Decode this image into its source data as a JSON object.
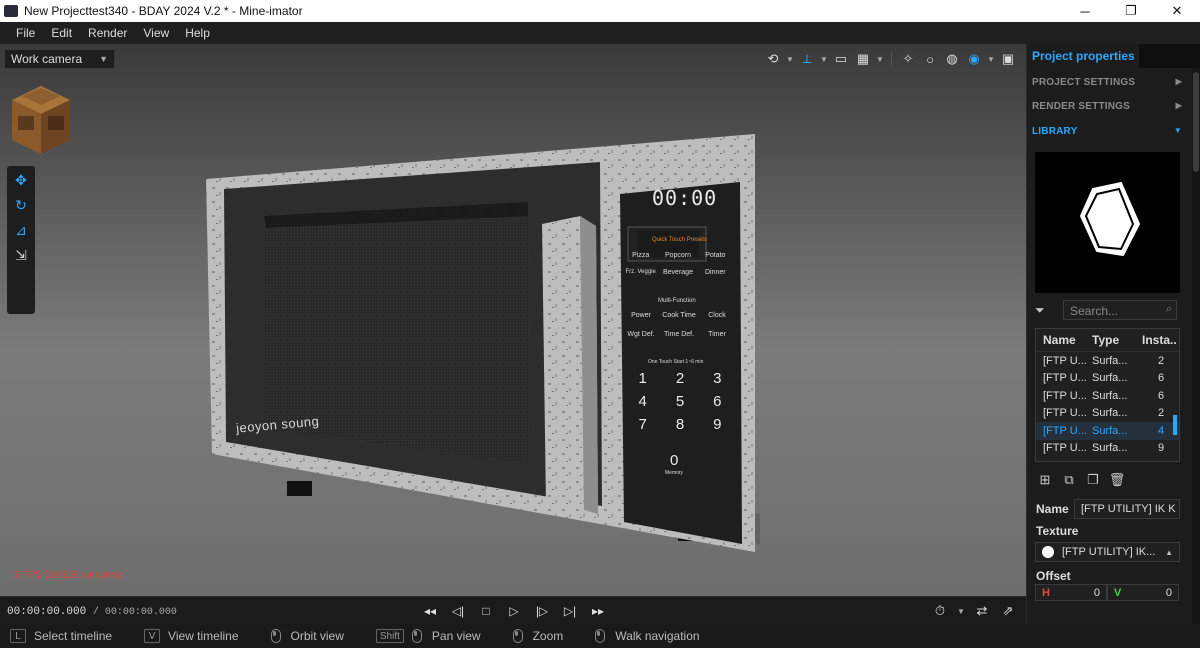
{
  "window": {
    "title": "New Projecttest340 - BDAY 2024 V.2 * - Mine-imator",
    "minimize": "─",
    "maximize": "❐",
    "close": "✕"
  },
  "menu": {
    "file": "File",
    "edit": "Edit",
    "render": "Render",
    "view": "View",
    "help": "Help"
  },
  "viewport": {
    "camera": "Work camera",
    "fps": "3 FPS (18/128 samples)"
  },
  "microwave": {
    "clock": "00:00",
    "presets_title": "Quick Touch Presets",
    "presets": [
      "Pizza",
      "Popcorn",
      "Potato",
      "Frz. Veggie",
      "Beverage",
      "Dinner"
    ],
    "multi_title": "Multi-Function",
    "multi": [
      "Power",
      "Cook Time",
      "Clock",
      "Wgt Def.",
      "Time Def.",
      "Timer"
    ],
    "start_title": "One Touch Start 1~6 min",
    "digits": [
      "1",
      "2",
      "3",
      "4",
      "5",
      "6",
      "7",
      "8",
      "9"
    ],
    "zero": "0",
    "memory": "Memory",
    "brand": "jeoyon soung"
  },
  "timeline": {
    "current": "00:00:00.000",
    "duration": "/ 00:00:00.000"
  },
  "status": {
    "select_key": "L",
    "select_timeline": "Select timeline",
    "view_key": "V",
    "view_timeline": "View timeline",
    "orbit_view": "Orbit view",
    "shift_key": "Shift",
    "pan_view": "Pan view",
    "zoom": "Zoom",
    "walk_navigation": "Walk navigation"
  },
  "panel": {
    "tab": "Project properties",
    "project_settings": "PROJECT SETTINGS",
    "render_settings": "RENDER SETTINGS",
    "library": "LIBRARY",
    "search_placeholder": "Search...",
    "columns": [
      "Name",
      "Type",
      "Insta..."
    ],
    "rows": [
      {
        "name": "[FTP U...",
        "type": "Surfa...",
        "count": "2"
      },
      {
        "name": "[FTP U...",
        "type": "Surfa...",
        "count": "6"
      },
      {
        "name": "[FTP U...",
        "type": "Surfa...",
        "count": "6"
      },
      {
        "name": "[FTP U...",
        "type": "Surfa...",
        "count": "2"
      },
      {
        "name": "[FTP U...",
        "type": "Surfa...",
        "count": "4"
      },
      {
        "name": "[FTP U...",
        "type": "Surfa...",
        "count": "9"
      }
    ],
    "selected_row": 4,
    "name_label": "Name",
    "name_value": "[FTP UTILITY] IK K",
    "texture_label": "Texture",
    "texture_value": "[FTP UTILITY] IK...",
    "offset_label": "Offset",
    "offset_h_label": "H",
    "offset_h": "0",
    "offset_v_label": "V",
    "offset_v": "0"
  },
  "colors": {
    "accent": "#2ea7ff",
    "fps_text": "#d94a3a",
    "offset_h": "#e24a3a",
    "offset_v": "#4ecb4e"
  }
}
